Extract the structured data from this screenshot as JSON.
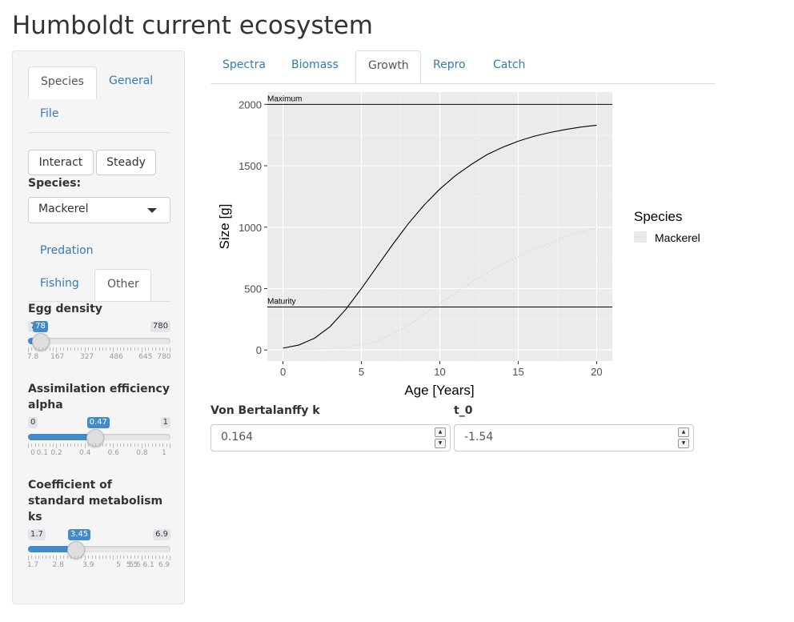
{
  "page": {
    "title": "Humboldt current ecosystem"
  },
  "sidebar": {
    "top_tabs": [
      {
        "label": "Species",
        "active": true
      },
      {
        "label": "General",
        "active": false
      },
      {
        "label": "File",
        "active": false
      }
    ],
    "buttons": {
      "interact": "Interact",
      "steady": "Steady"
    },
    "species_label": "Species:",
    "species_select": {
      "value": "Mackerel"
    },
    "sub_tabs": [
      {
        "label": "Predation",
        "active": false
      },
      {
        "label": "Fishing",
        "active": false
      },
      {
        "label": "Other",
        "active": true
      }
    ],
    "sliders": [
      {
        "label": "Egg density",
        "min_label": "7.8",
        "max_label": "780",
        "value_label": "78",
        "min": 7.8,
        "max": 780,
        "value": 78,
        "tick_labels": [
          "7.8",
          "167",
          "327",
          "486",
          "645",
          "780"
        ]
      },
      {
        "label": "Assimilation efficiency alpha",
        "min_label": "0",
        "max_label": "1",
        "value_label": "0.47",
        "min": 0,
        "max": 1,
        "value": 0.47,
        "tick_labels": [
          "0",
          "0.1",
          "0.2",
          "0.4",
          "0.6",
          "0.8",
          "1"
        ]
      },
      {
        "label": "Coefficient of standard metabolism ks",
        "min_label": "1.7",
        "max_label": "6.9",
        "value_label": "3.45",
        "min": 1.7,
        "max": 6.9,
        "value": 3.45,
        "tick_labels": [
          "1.7",
          "2.8",
          "3.9",
          "5",
          "5.5",
          "5.6",
          "6.1",
          "6.9"
        ]
      }
    ]
  },
  "main": {
    "tabs": [
      {
        "label": "Spectra",
        "active": false
      },
      {
        "label": "Biomass",
        "active": false
      },
      {
        "label": "Growth",
        "active": true
      },
      {
        "label": "Repro",
        "active": false
      },
      {
        "label": "Catch",
        "active": false
      }
    ],
    "inputs": {
      "k_label": "Von Bertalanffy k",
      "k_value": "0.164",
      "t0_label": "t_0",
      "t0_value": "-1.54"
    }
  },
  "chart_data": {
    "type": "line",
    "xlabel": "Age [Years]",
    "ylabel": "Size [g]",
    "xlim": [
      -1,
      21
    ],
    "ylim": [
      -90,
      2100
    ],
    "x_ticks": [
      0,
      5,
      10,
      15,
      20
    ],
    "y_ticks": [
      0,
      500,
      1000,
      1500,
      2000
    ],
    "grid": true,
    "legend": {
      "title": "Species",
      "entries": [
        "Mackerel"
      ],
      "placement": "right"
    },
    "series": [
      {
        "name": "",
        "style": "solid",
        "color": "#000000",
        "x": [
          0,
          1,
          2,
          3,
          4,
          5,
          6,
          7,
          8,
          9,
          10,
          11,
          12,
          13,
          14,
          15,
          16,
          17,
          18,
          19,
          20
        ],
        "y": [
          15,
          40,
          95,
          190,
          330,
          500,
          680,
          860,
          1030,
          1180,
          1310,
          1420,
          1510,
          1590,
          1650,
          1700,
          1740,
          1770,
          1795,
          1815,
          1830
        ]
      },
      {
        "name": "Mackerel",
        "style": "dotted",
        "color": "#cccccc",
        "x": [
          0,
          2,
          4,
          6,
          8,
          10,
          12,
          14,
          16,
          18,
          20
        ],
        "y": [
          0,
          5,
          20,
          70,
          200,
          380,
          550,
          700,
          820,
          920,
          1000
        ]
      }
    ],
    "hlines": [
      {
        "y": 2000,
        "label": "Maximum"
      },
      {
        "y": 350,
        "label": "Maturity"
      }
    ]
  },
  "colors": {
    "accent": "#428bca",
    "link": "#337ab7",
    "panel_bg": "#ebebeb",
    "grid": "#ffffff"
  }
}
